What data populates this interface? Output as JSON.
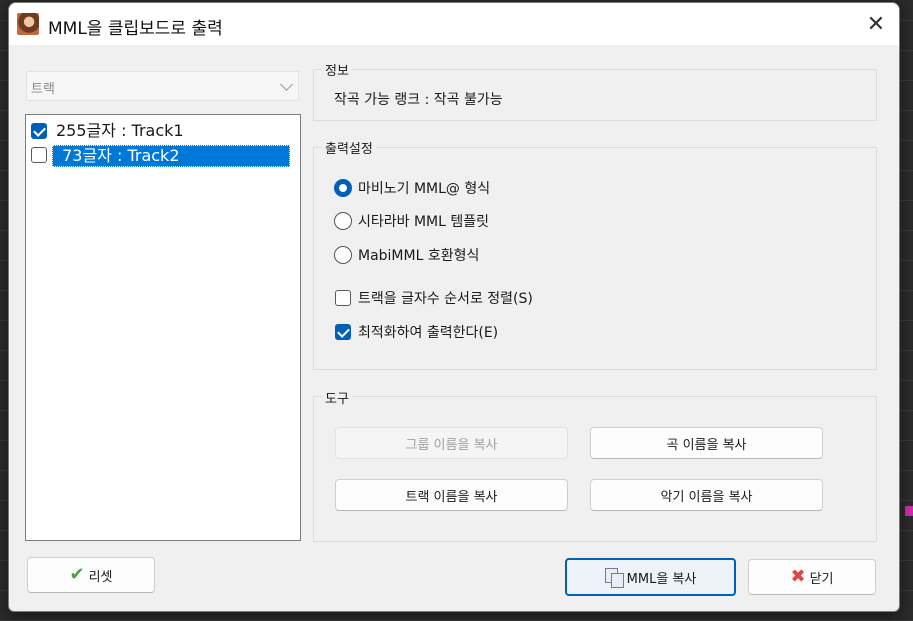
{
  "window": {
    "title": "MML을 클립보드로 출력",
    "close_glyph": "✕"
  },
  "track_combo": {
    "value": "트랙"
  },
  "tracks": [
    {
      "label": "255글자 : Track1",
      "checked": true,
      "selected": false
    },
    {
      "label": " 73글자 : Track2",
      "checked": false,
      "selected": true
    }
  ],
  "info": {
    "title": "정보",
    "text": "작곡 가능 랭크 : 작곡 불가능"
  },
  "output": {
    "title": "출력설정",
    "formats": [
      {
        "label": "마비노기 MML@ 형식",
        "selected": true
      },
      {
        "label": "시타라바 MML 템플릿",
        "selected": false
      },
      {
        "label": "MabiMML 호환형식",
        "selected": false
      }
    ],
    "options": [
      {
        "label": "트랙을 글자수 순서로 정렬(S)",
        "checked": false
      },
      {
        "label": "최적화하여 출력한다(E)",
        "checked": true
      }
    ]
  },
  "tools": {
    "title": "도구",
    "buttons": {
      "group_name": "그룹 이름을 복사",
      "song_name": "곡 이름을 복사",
      "track_name": "트랙 이름을 복사",
      "instrument_name": "악기 이름을 복사"
    }
  },
  "footer": {
    "reset": "리셋",
    "copy_mml": "MML을 복사",
    "close": "닫기"
  },
  "colors": {
    "accent": "#005fb8",
    "selection": "#0078d7"
  }
}
